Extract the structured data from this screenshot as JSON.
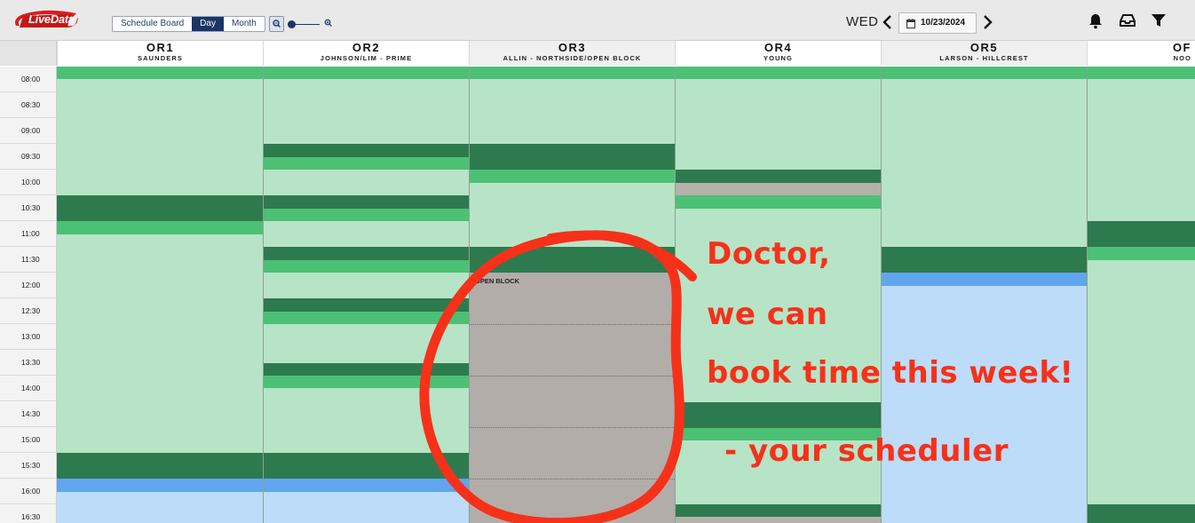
{
  "app": {
    "logo_text": "LiveData"
  },
  "toolbar": {
    "views": [
      {
        "label": "Schedule Board",
        "active": false
      },
      {
        "label": "Day",
        "active": true
      },
      {
        "label": "Month",
        "active": false
      }
    ],
    "zoom_icons": [
      "zoom-out-icon",
      "zoom-in-icon"
    ],
    "day_label": "WED",
    "date_value": "10/23/2024",
    "right_icons": [
      "bell-icon",
      "inbox-icon",
      "filter-icon"
    ]
  },
  "rooms": [
    {
      "name": "OR1",
      "surgeon": "SAUNDERS"
    },
    {
      "name": "OR2",
      "surgeon": "JOHNSON/LIM - PRIME"
    },
    {
      "name": "OR3",
      "surgeon": "ALLIN - NORTHSIDE/OPEN BLOCK"
    },
    {
      "name": "OR4",
      "surgeon": "YOUNG"
    },
    {
      "name": "OR5",
      "surgeon": "LARSON - HILLCREST"
    },
    {
      "name": "OF",
      "surgeon": "NOO"
    }
  ],
  "times": [
    "08:00",
    "08:30",
    "09:00",
    "09:30",
    "10:00",
    "10:30",
    "11:00",
    "11:30",
    "12:00",
    "12:30",
    "13:00",
    "13:30",
    "14:00",
    "14:30",
    "15:00",
    "15:30",
    "16:00",
    "16:30"
  ],
  "open_block_label": "OPEN BLOCK",
  "colors": {
    "case_light": "#b7e4c6",
    "case_edge": "#4cc075",
    "turnover": "#2e7a4f",
    "unassigned": "#b5b1ab",
    "released_edge": "#60a5ee",
    "released": "#bcdcf9",
    "annotation": "#f5311a",
    "header_navy": "#1a3566"
  },
  "annotation": {
    "lines": [
      "Doctor,",
      "we can",
      "book time this week!",
      "- your scheduler"
    ]
  }
}
